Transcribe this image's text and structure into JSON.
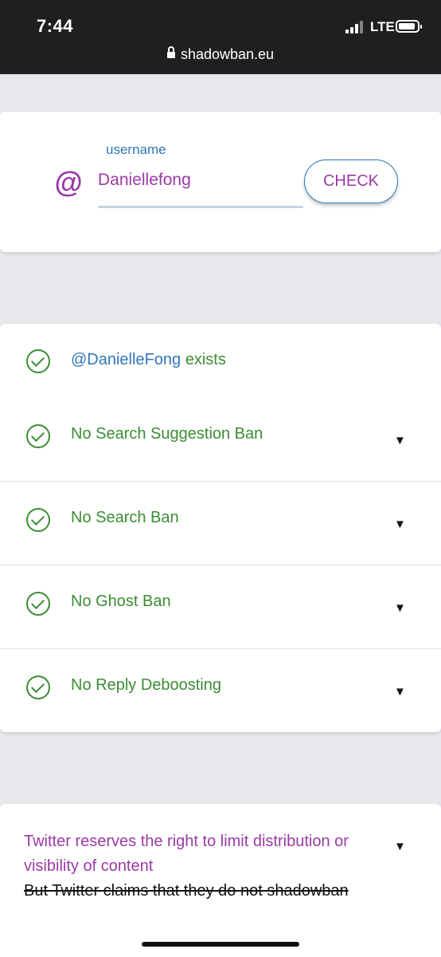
{
  "status_bar": {
    "time": "7:44",
    "network": "LTE"
  },
  "browser": {
    "url": "shadowban.eu"
  },
  "search": {
    "at_symbol": "@",
    "label": "username",
    "value": "Daniellefong",
    "button_label": "CHECK"
  },
  "results": {
    "exists": {
      "handle": "@DanielleFong",
      "suffix": " exists"
    },
    "items": [
      {
        "label": "No Search Suggestion Ban",
        "expand_icon": "▼"
      },
      {
        "label": "No Search Ban",
        "expand_icon": "▼"
      },
      {
        "label": "No Ghost Ban",
        "expand_icon": "▼"
      },
      {
        "label": "No Reply Deboosting",
        "expand_icon": "▼"
      }
    ]
  },
  "footer": {
    "notice": "Twitter reserves the right to limit distribution or visibility of content",
    "struck_text": "But Twitter claims that they do not shadowban",
    "expand_icon": "▼"
  },
  "colors": {
    "purple": "#9b3aa6",
    "blue": "#2f76b8",
    "green": "#3c8c34",
    "status_bar": "#1f1f1f"
  }
}
